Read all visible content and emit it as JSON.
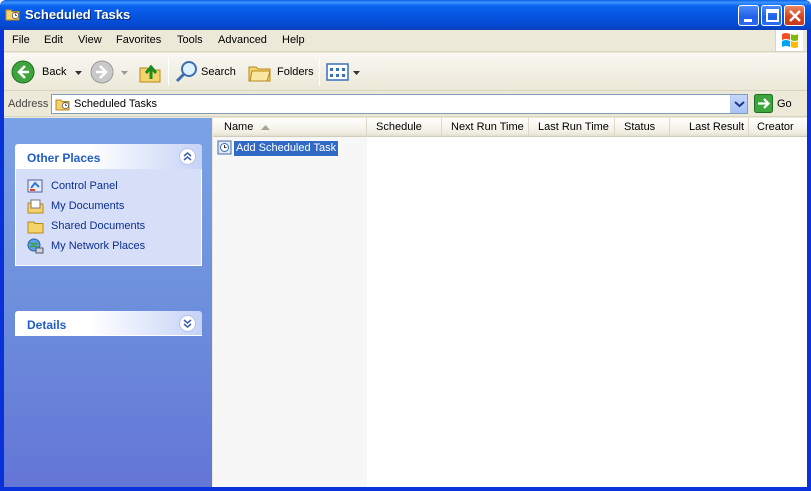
{
  "window": {
    "title": "Scheduled Tasks"
  },
  "menu": [
    "File",
    "Edit",
    "View",
    "Favorites",
    "Tools",
    "Advanced",
    "Help"
  ],
  "toolbar": {
    "back_label": "Back",
    "search_label": "Search",
    "folders_label": "Folders"
  },
  "address": {
    "label": "Address",
    "value": "Scheduled Tasks",
    "go_label": "Go"
  },
  "sidebar": {
    "other_places": {
      "title": "Other Places",
      "items": [
        {
          "label": "Control Panel",
          "icon": "control-panel-icon"
        },
        {
          "label": "My Documents",
          "icon": "my-documents-icon"
        },
        {
          "label": "Shared Documents",
          "icon": "shared-folder-icon"
        },
        {
          "label": "My Network Places",
          "icon": "network-places-icon"
        }
      ]
    },
    "details": {
      "title": "Details"
    }
  },
  "list": {
    "columns": [
      "Name",
      "Schedule",
      "Next Run Time",
      "Last Run Time",
      "Status",
      "Last Result",
      "Creator"
    ],
    "items": [
      {
        "label": "Add Scheduled Task",
        "selected": true
      }
    ]
  },
  "colors": {
    "title_bar": "#0554e0",
    "task_pane": "#6d8fdc",
    "panel_title": "#215dc6",
    "selection": "#316ac5"
  }
}
